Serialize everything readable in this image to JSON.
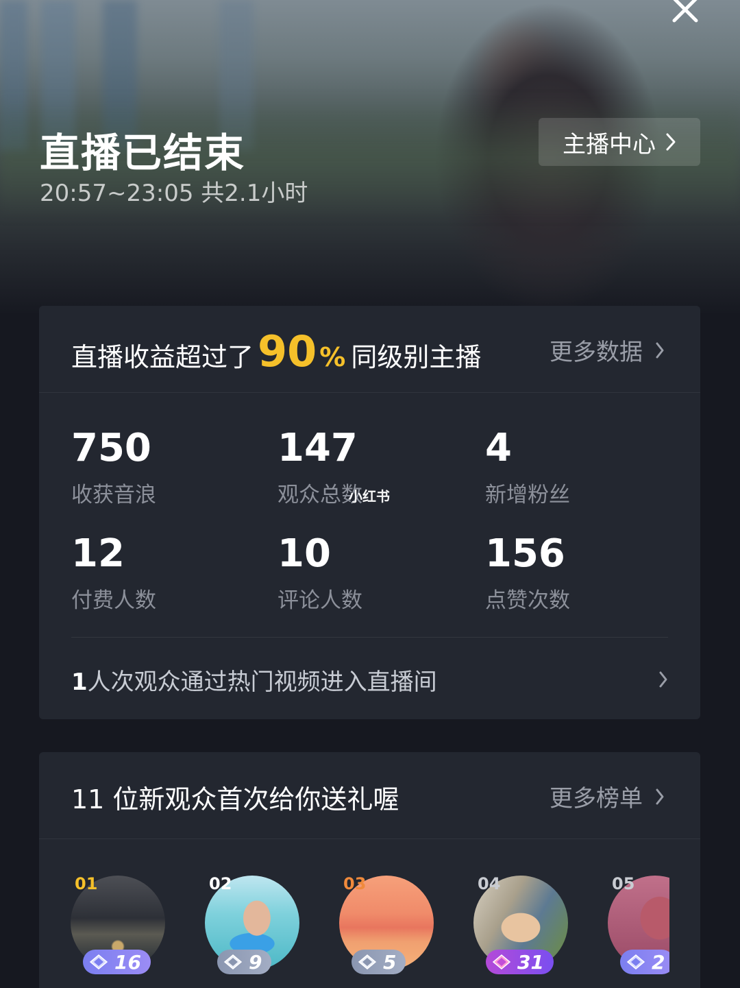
{
  "header": {
    "title": "直播已结束",
    "time_range": "20:57~23:05 共2.1小时",
    "anchor_center_label": "主播中心"
  },
  "revenue": {
    "prefix": "直播收益超过了",
    "percent": "90",
    "percent_sign": "%",
    "suffix": "同级别主播",
    "more_label": "更多数据"
  },
  "stats": [
    {
      "value": "750",
      "label": "收获音浪"
    },
    {
      "value": "147",
      "label": "观众总数"
    },
    {
      "value": "4",
      "label": "新增粉丝"
    },
    {
      "value": "12",
      "label": "付费人数"
    },
    {
      "value": "10",
      "label": "评论人数"
    },
    {
      "value": "156",
      "label": "点赞次数"
    }
  ],
  "watermark": "小红书",
  "hot_video": {
    "count": "1",
    "text": "人次观众通过热门视频进入直播间"
  },
  "gifts": {
    "title": "11 位新观众首次给你送礼喔",
    "more_label": "更多榜单",
    "donors": [
      {
        "rank": "01",
        "gifts": "16",
        "rank_color": "#f5c02a"
      },
      {
        "rank": "02",
        "gifts": "9",
        "rank_color": "#ffffff"
      },
      {
        "rank": "03",
        "gifts": "5",
        "rank_color": "#f08a3c"
      },
      {
        "rank": "04",
        "gifts": "31",
        "rank_color": "#c9ccd2"
      },
      {
        "rank": "05",
        "gifts": "2",
        "rank_color": "#c9ccd2"
      }
    ]
  },
  "colors": {
    "accent_gold": "#f5c02a",
    "card_bg": "#232730",
    "page_bg": "#161820"
  }
}
